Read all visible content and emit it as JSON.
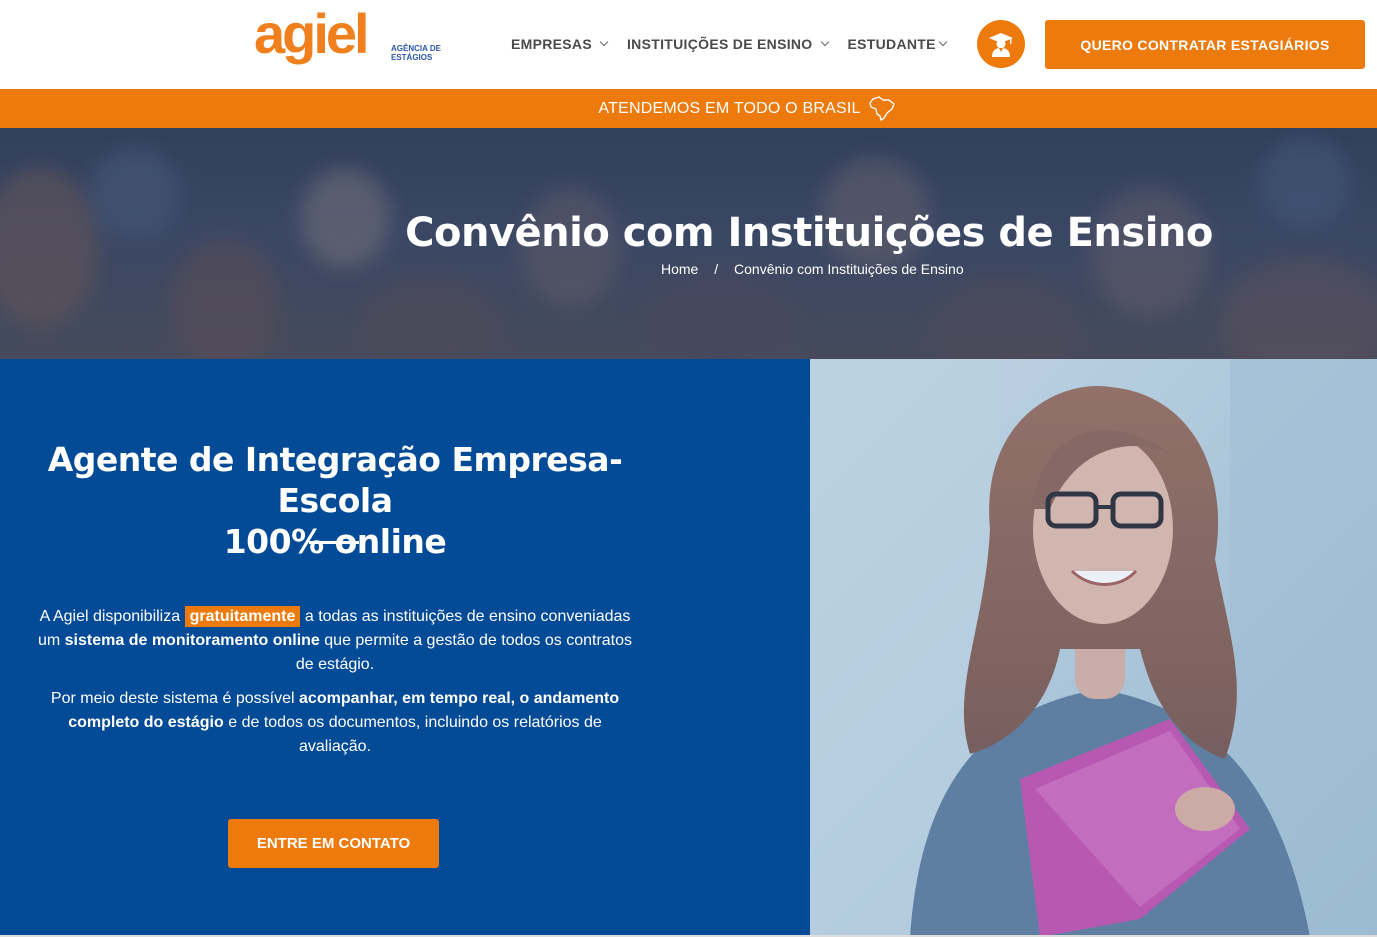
{
  "header": {
    "logo_text": "agiel",
    "logo_sub_1": "AGÊNCIA DE",
    "logo_sub_2": "ESTÁGIOS",
    "nav": [
      {
        "label": "EMPRESAS"
      },
      {
        "label": "INSTITUIÇÕES DE ENSINO"
      },
      {
        "label": "ESTUDANTE"
      }
    ],
    "student_icon": "graduate-icon",
    "cta_label": "QUERO CONTRATAR ESTAGIÁRIOS"
  },
  "banner": {
    "text": "ATENDEMOS EM TODO O BRASIL",
    "icon": "brazil-map-icon"
  },
  "hero": {
    "title": "Convênio com Instituições de Ensino",
    "breadcrumb": {
      "home": "Home",
      "separator": "/",
      "current": "Convênio com Instituições de Ensino"
    }
  },
  "info": {
    "title_line1": "Agente de Integração Empresa-Escola",
    "title_line2": "100% online",
    "p1": {
      "a": "A Agiel disponibiliza",
      "highlight": "gratuitamente",
      "b": "a todas as instituições de ensino conveniadas um",
      "bold": "sistema de monitoramento online",
      "c": "que permite a gestão de todos os contratos de estágio."
    },
    "p2": {
      "a": "Por meio deste sistema é possível",
      "bold1": "acompanhar, em tempo real, o andamento completo do estágio",
      "b": "e de todos os documentos, incluindo os relatórios de avaliação."
    },
    "cta_label": "ENTRE EM CONTATO"
  },
  "colors": {
    "accent": "#ec7a0d",
    "blue": "#034a97"
  }
}
